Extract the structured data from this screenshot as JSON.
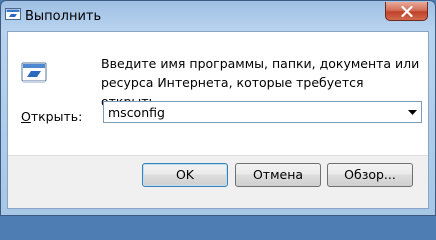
{
  "window": {
    "title": "Выполнить",
    "icon": "run-icon"
  },
  "titlebar": {
    "close_icon": "close-icon"
  },
  "main": {
    "description": "Введите имя программы, папки, документа или ресурса Интернета, которые требуется открыть.",
    "open_label": "Открыть:",
    "open_value": "msconfig",
    "dropdown_icon": "chevron-down-icon"
  },
  "buttons": {
    "ok": "OK",
    "cancel": "Отмена",
    "browse": "Обзор..."
  }
}
